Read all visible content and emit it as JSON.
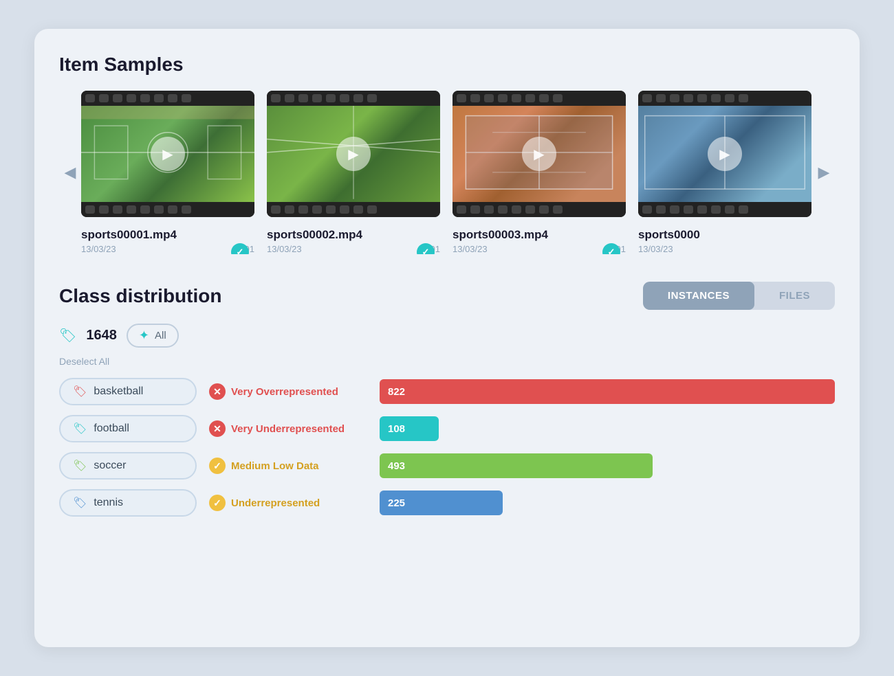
{
  "page": {
    "title": "Item Samples",
    "class_dist_title": "Class distribution"
  },
  "samples": {
    "videos": [
      {
        "id": "video-1",
        "name": "sports00001.mp4",
        "date": "13/03/23",
        "code": "0001",
        "checked": true
      },
      {
        "id": "video-2",
        "name": "sports00002.mp4",
        "date": "13/03/23",
        "code": "0001",
        "checked": true
      },
      {
        "id": "video-3",
        "name": "sports00003.mp4",
        "date": "13/03/23",
        "code": "0001",
        "checked": true
      },
      {
        "id": "video-4",
        "name": "sports0000",
        "date": "13/03/23",
        "code": "",
        "checked": false
      }
    ],
    "prev_arrow": "◀",
    "next_arrow": "▶"
  },
  "class_distribution": {
    "instances_count": "1648",
    "all_label": "All",
    "deselect_all_label": "Deselect All",
    "toggle_instances": "INSTANCES",
    "toggle_files": "FILES",
    "classes": [
      {
        "name": "basketball",
        "tag_color": "red",
        "status": "Very Overrepresented",
        "status_color": "red",
        "count": 822,
        "bar_color": "red",
        "bar_width_pct": 100
      },
      {
        "name": "football",
        "tag_color": "teal",
        "status": "Very Underrepresented",
        "status_color": "red",
        "count": 108,
        "bar_color": "teal",
        "bar_width_pct": 13
      },
      {
        "name": "soccer",
        "tag_color": "green",
        "status": "Medium Low Data",
        "status_color": "yellow",
        "count": 493,
        "bar_color": "green",
        "bar_width_pct": 60
      },
      {
        "name": "tennis",
        "tag_color": "blue",
        "status": "Underrepresented",
        "status_color": "yellow",
        "count": 225,
        "bar_color": "blue",
        "bar_width_pct": 27
      }
    ]
  }
}
